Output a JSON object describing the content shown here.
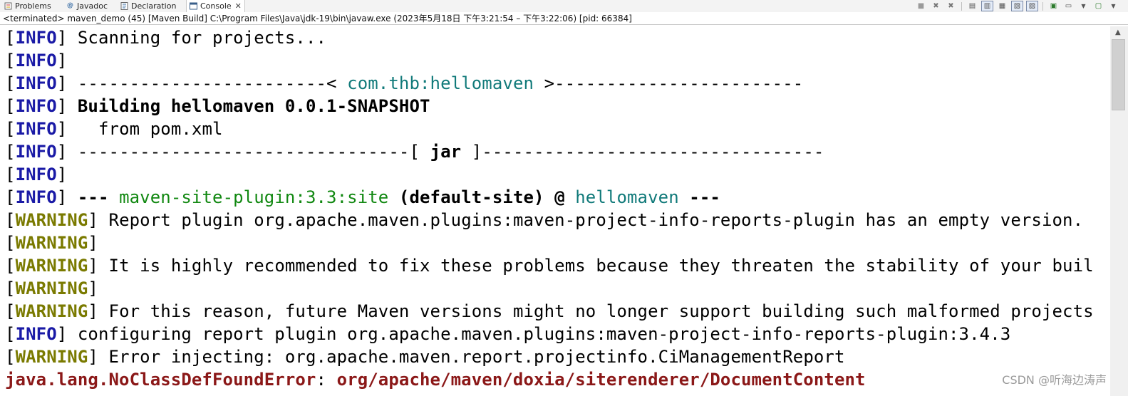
{
  "tabs": [
    {
      "label": "Problems",
      "icon": "problems-icon"
    },
    {
      "label": "Javadoc",
      "icon": "javadoc-icon"
    },
    {
      "label": "Declaration",
      "icon": "declaration-icon"
    },
    {
      "label": "Console",
      "icon": "console-icon",
      "active": true
    }
  ],
  "process_label": "<terminated> maven_demo (45) [Maven Build] C:\\Program Files\\Java\\jdk-19\\bin\\javaw.exe  (2023年5月18日 下午3:21:54 – 下午3:22:06) [pid: 66384]",
  "console": {
    "info": "INFO",
    "warning": "WARNING",
    "l1": "Scanning for projects...",
    "l3a": "------------------------< ",
    "l3b": "com.thb:hellomaven",
    "l3c": " >------------------------",
    "l4": "Building hellomaven 0.0.1-SNAPSHOT",
    "l5": "  from pom.xml",
    "l6a": "--------------------------------[ ",
    "l6b": "jar",
    "l6c": " ]---------------------------------",
    "l8a": "--- ",
    "l8b": "maven-site-plugin:3.3:site",
    "l8c": " (default-site) @ ",
    "l8d": "hellomaven",
    "l8e": " ---",
    "l9": "Report plugin org.apache.maven.plugins:maven-project-info-reports-plugin has an empty version.",
    "l11": "It is highly recommended to fix these problems because they threaten the stability of your buil",
    "l13": "For this reason, future Maven versions might no longer support building such malformed projects",
    "l14": "configuring report plugin org.apache.maven.plugins:maven-project-info-reports-plugin:3.4.3",
    "l15": "Error injecting: org.apache.maven.report.projectinfo.CiManagementReport",
    "l16a": "java.lang.NoClassDefFoundError",
    "l16b": ": ",
    "l16c": "org/apache/maven/doxia/siterenderer/DocumentContent"
  },
  "watermark": "CSDN @听海边涛声",
  "colors": {
    "info_tag": "#1a1aa6",
    "warning_tag": "#7a7a00",
    "teal": "#117a7a",
    "green": "#118811",
    "error": "#8b1818"
  }
}
